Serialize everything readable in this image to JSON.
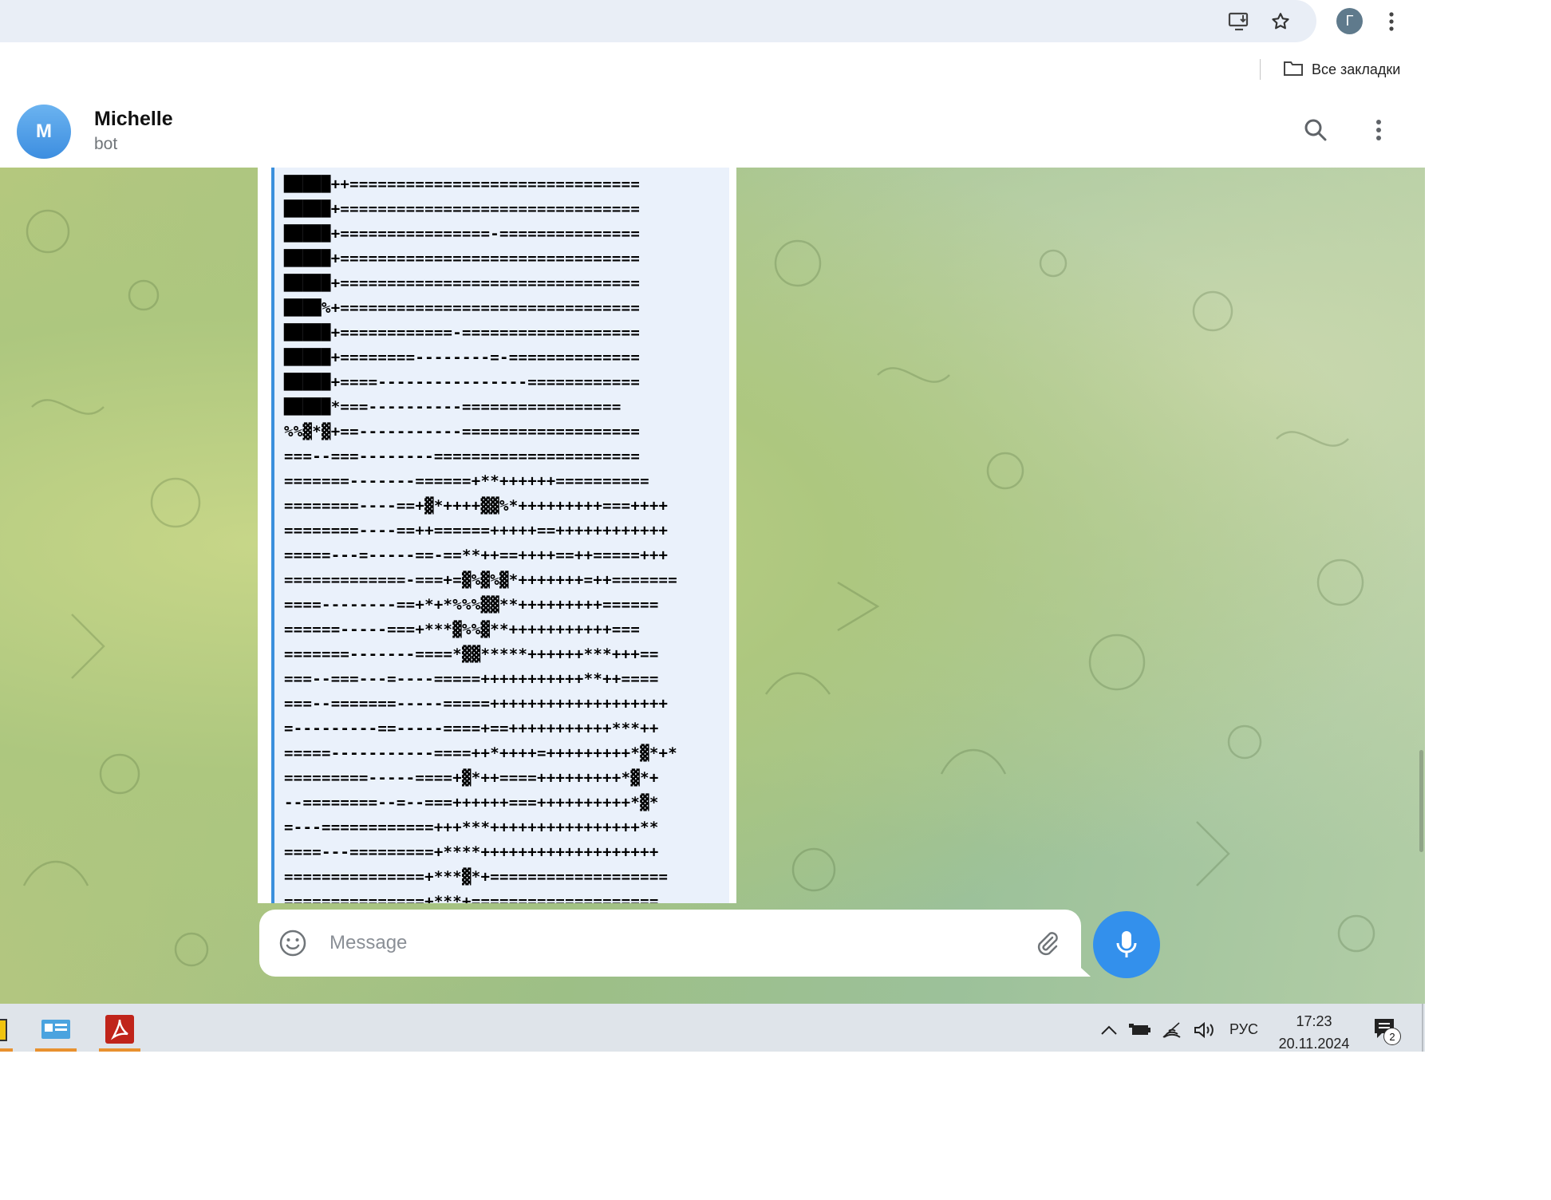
{
  "browser": {
    "profile_initial": "Г",
    "bookmarks_label": "Все закладки"
  },
  "chat": {
    "avatar_letter": "M",
    "name": "Michelle",
    "status": "bot"
  },
  "message": {
    "ascii_art": [
      "█████++===============================",
      "█████+================================",
      "█████+================-===============",
      "█████+================================",
      "█████+================================",
      "████%+================================",
      "█████+============-===================",
      "█████+========--------=-==============",
      "█████+====----------------============",
      "█████*===----------=================",
      "%%▓*▓+==-----------===================",
      "===--===--------======================",
      "=======-------======+**++++++==========",
      "========----==+▓*++++▓▓%*+++++++++===++++",
      "========----==++======+++++==++++++++++++",
      "=====---=-----==-==**++==++++==++=====+++",
      "=============-===+=▓%▓%▓*+++++++=++=======",
      "====--------==+*+*%%%▓▓**+++++++++======",
      "======-----===+***▓%%▓**+++++++++++===",
      "=======-------====*▓▓*****++++++***+++==",
      "===--===---=----=====+++++++++++**++====",
      "===--=======-----=====+++++++++++++++++++",
      "=---------==-----====+==+++++++++++***++",
      "=====-----------====++*++++=+++++++++*▓*+*",
      "=========-----====+▓*++====+++++++++*▓*+",
      "--========--=--===++++++===++++++++++*▓*",
      "=---============+++***++++++++++++++++**",
      "====---=========+****+++++++++++++++++++",
      "===============+***▓*+===================",
      "===============+***+===================="
    ],
    "composer_placeholder": "Message"
  },
  "taskbar": {
    "language": "РУС",
    "time": "17:23",
    "date": "20.11.2024",
    "notification_count": "2"
  },
  "colors": {
    "accent": "#3390ec",
    "quote_border": "#3a8fdc",
    "taskbar_bg": "#dfe4ea",
    "omnibox_bg": "#e9eef6"
  }
}
